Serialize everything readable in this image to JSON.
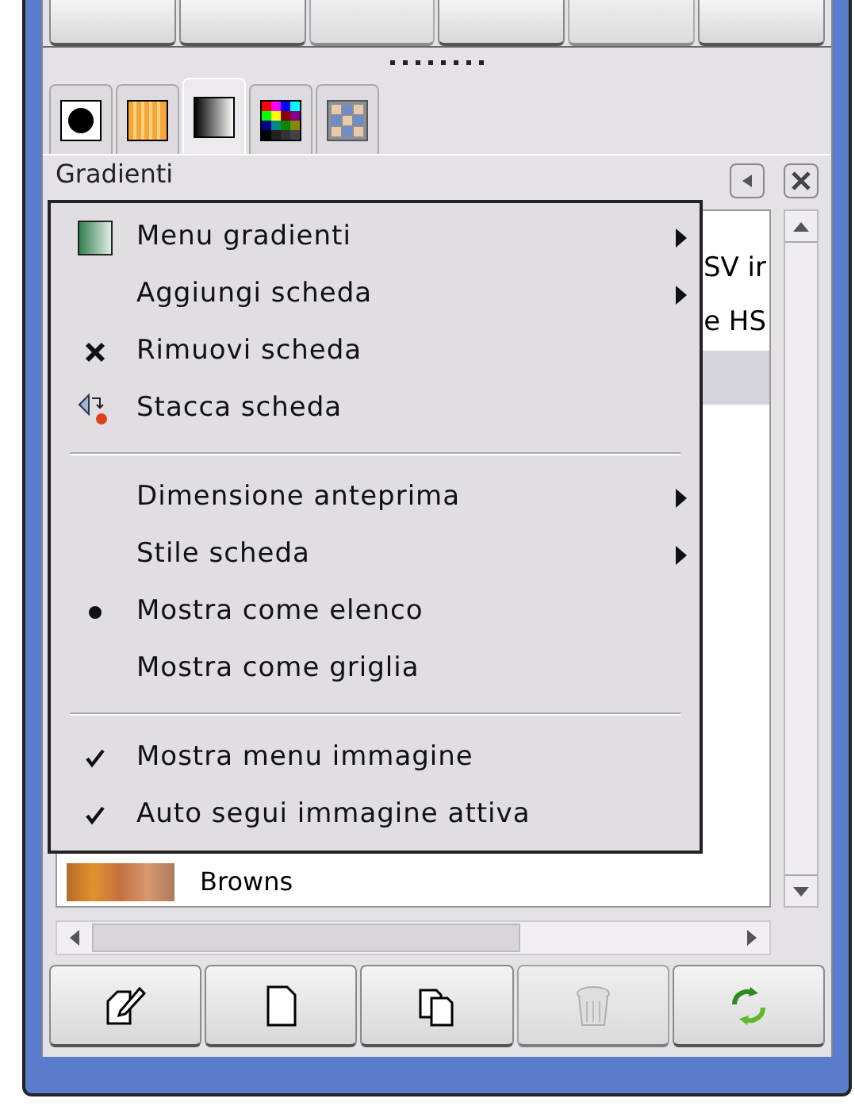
{
  "top_buttons": [
    {
      "disabled": false
    },
    {
      "disabled": false
    },
    {
      "disabled": true
    },
    {
      "disabled": false
    },
    {
      "disabled": true
    },
    {
      "disabled": false
    }
  ],
  "tabs": [
    {
      "kind": "brush",
      "selected": false
    },
    {
      "kind": "pattern",
      "selected": false
    },
    {
      "kind": "gradient",
      "selected": true
    },
    {
      "kind": "palette",
      "selected": false
    },
    {
      "kind": "font",
      "selected": false
    }
  ],
  "panel": {
    "title": "Gradienti"
  },
  "list_rows": [
    {
      "label": "SV ir",
      "selected": false
    },
    {
      "label": "e HS",
      "selected": false
    },
    {
      "selected": true
    }
  ],
  "last_row": {
    "label": "Browns"
  },
  "menu": [
    {
      "kind": "item",
      "label": "Menu gradienti",
      "submenu": true
    },
    {
      "kind": "item",
      "label": "Aggiungi scheda",
      "submenu": true
    },
    {
      "kind": "item",
      "label": "Rimuovi scheda",
      "submenu": false
    },
    {
      "kind": "item",
      "label": "Stacca scheda",
      "submenu": false
    },
    {
      "kind": "separator"
    },
    {
      "kind": "item",
      "label": "Dimensione anteprima",
      "submenu": true
    },
    {
      "kind": "item",
      "label": "Stile scheda",
      "submenu": true
    },
    {
      "kind": "radio",
      "label": "Mostra come elenco",
      "selected": true
    },
    {
      "kind": "radio",
      "label": "Mostra come griglia",
      "selected": false
    },
    {
      "kind": "separator"
    },
    {
      "kind": "check",
      "label": "Mostra menu immagine",
      "checked": true
    },
    {
      "kind": "check",
      "label": "Auto segui immagine attiva",
      "checked": true
    }
  ],
  "bottom_buttons": [
    {
      "kind": "edit",
      "disabled": false
    },
    {
      "kind": "new",
      "disabled": false
    },
    {
      "kind": "duplicate",
      "disabled": false
    },
    {
      "kind": "delete",
      "disabled": true
    },
    {
      "kind": "refresh",
      "disabled": false
    }
  ]
}
